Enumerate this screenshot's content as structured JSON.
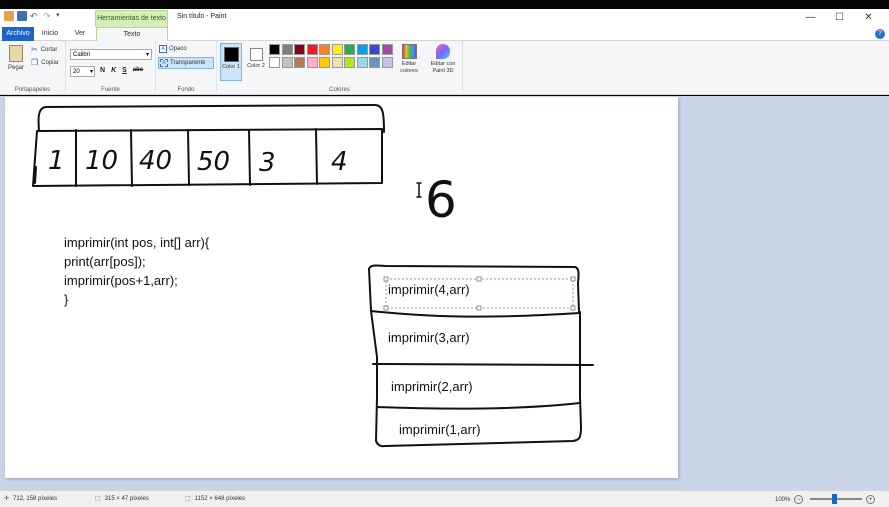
{
  "window": {
    "context_tab": "Herramientas de texto",
    "title": "Sin título - Paint",
    "controls": [
      "—",
      "☐",
      "✕"
    ]
  },
  "tabs": [
    "Archivo",
    "Inicio",
    "Ver",
    "Texto"
  ],
  "ribbon": {
    "portapapeles": {
      "pegar": "Pegar",
      "cortar": "Cortar",
      "copiar": "Copiar",
      "label": "Portapapeles"
    },
    "fuente": {
      "font": "Calibri",
      "size": "20",
      "bold": "N",
      "italic": "K",
      "underline": "S",
      "strike": "abc",
      "label": "Fuente"
    },
    "fondo": {
      "opaco": "Opaco",
      "transparente": "Transparente",
      "label": "Fondo"
    },
    "colores": {
      "color1": "Color\n1",
      "color1_label": "Color 1",
      "color2_label": "Color 2",
      "editar": "Editar colores",
      "paint3d": "Editar con Paint 3D",
      "label": "Colores",
      "palette_row1": [
        "#000000",
        "#7f7f7f",
        "#880015",
        "#ed1c24",
        "#ff7f27",
        "#fff200",
        "#22b14c",
        "#00a2e8",
        "#3f48cc",
        "#a349a4"
      ],
      "palette_row2": [
        "#ffffff",
        "#c3c3c3",
        "#b97a57",
        "#ffaec9",
        "#ffc90e",
        "#efe4b0",
        "#b5e61d",
        "#99d9ea",
        "#7092be",
        "#c8bfe7"
      ]
    }
  },
  "canvas": {
    "array_values": [
      "1",
      "10",
      "40",
      "50",
      "3",
      "4"
    ],
    "n_value": "6",
    "code_lines": [
      "imprimir(int pos, int[] arr){",
      "print(arr[pos]);",
      "imprimir(pos+1,arr);",
      "}"
    ],
    "stack": [
      "imprimir(4,arr)",
      "imprimir(3,arr)",
      "imprimir(2,arr)",
      "imprimir(1,arr)"
    ]
  },
  "status": {
    "cursor": "712, 158 píxeles",
    "selection": "315 × 47 píxeles",
    "size": "1152 × 648 píxeles",
    "zoom": "100%"
  }
}
